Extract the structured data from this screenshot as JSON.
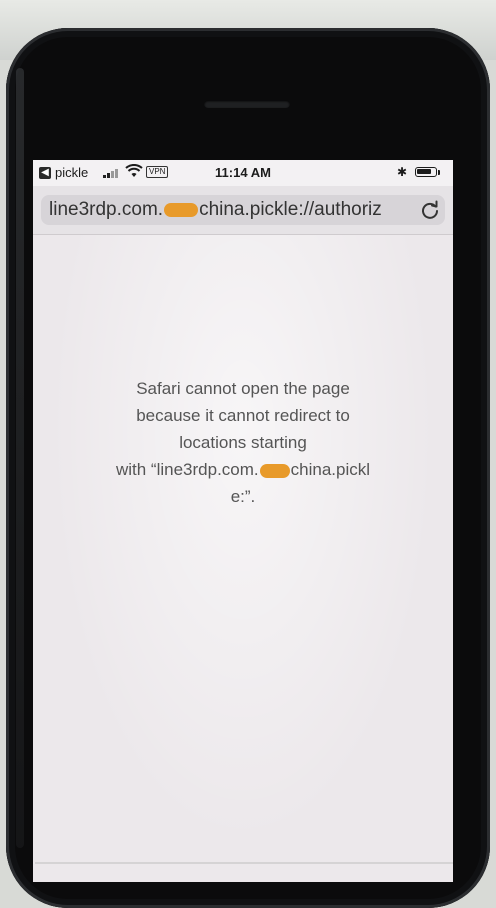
{
  "status_bar": {
    "back_app": "pickle",
    "vpn": "VPN",
    "time": "11:14 AM",
    "bluetooth_icon": "bluetooth-icon",
    "battery_level": 0.8
  },
  "address_bar": {
    "url_part1": "line3rdp.com.",
    "url_part2": "china.pickle://authoriz",
    "reload_icon": "reload-icon"
  },
  "error": {
    "line1": "Safari cannot open the page",
    "line2": "because it cannot redirect to",
    "line3": "locations starting",
    "line4_prefix": "with “line3rdp.com.",
    "line4_suffix": "china.pickl",
    "line5": "e:”."
  },
  "colors": {
    "redaction": "#e89a2a",
    "page_background": "#ece8eb"
  }
}
